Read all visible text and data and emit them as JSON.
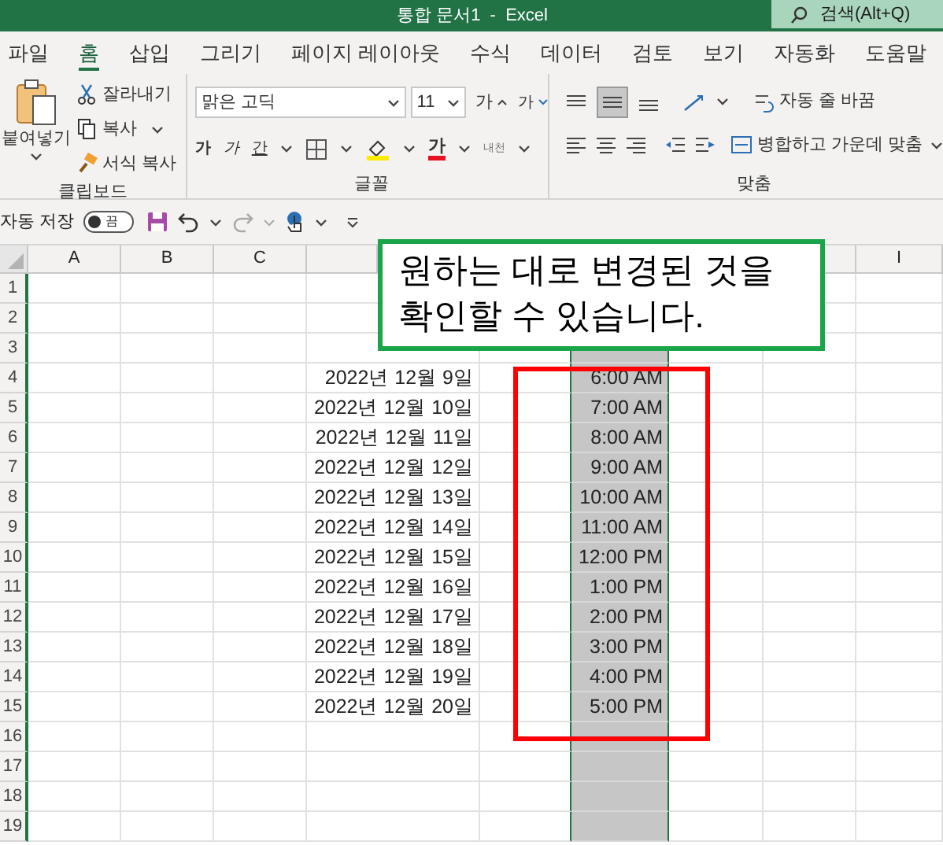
{
  "window": {
    "title": "통합 문서1  -  Excel",
    "search": {
      "placeholder": "검색(Alt+Q)"
    }
  },
  "tabs": [
    {
      "label": "파일",
      "selected": false
    },
    {
      "label": "홈",
      "selected": true
    },
    {
      "label": "삽입",
      "selected": false
    },
    {
      "label": "그리기",
      "selected": false
    },
    {
      "label": "페이지 레이아웃",
      "selected": false
    },
    {
      "label": "수식",
      "selected": false
    },
    {
      "label": "데이터",
      "selected": false
    },
    {
      "label": "검토",
      "selected": false
    },
    {
      "label": "보기",
      "selected": false
    },
    {
      "label": "자동화",
      "selected": false
    },
    {
      "label": "도움말",
      "selected": false
    }
  ],
  "ribbon": {
    "clipboard": {
      "paste": "붙여넣기",
      "cut": "잘라내기",
      "copy": "복사",
      "format_painter": "서식 복사",
      "label": "클립보드"
    },
    "font": {
      "font_name": "맑은 고딕",
      "font_size": "11",
      "grow": "가",
      "shrink": "가",
      "bold": "가",
      "italic": "가",
      "underline": "간",
      "font_color": "가",
      "phonetic": "내천",
      "label": "글꼴"
    },
    "alignment": {
      "wrap_text": "자동 줄 바꿈",
      "merge_center": "병합하고 가운데 맞춤",
      "label": "맞춤"
    }
  },
  "quick_access": {
    "autosave_label": "자동 저장",
    "autosave": {
      "on": false,
      "text": "끔"
    }
  },
  "columns": [
    "A",
    "B",
    "C",
    "I"
  ],
  "rows": [
    {
      "header": "1"
    },
    {
      "header": "2"
    },
    {
      "header": "3",
      "column_6_selected": true
    },
    {
      "header": "4",
      "date": "2022년 12월 9일",
      "time": "6:00 AM",
      "column_6_selected": true
    },
    {
      "header": "5",
      "date": "2022년 12월 10일",
      "time": "7:00 AM",
      "column_6_selected": true
    },
    {
      "header": "6",
      "date": "2022년 12월 11일",
      "time": "8:00 AM",
      "column_6_selected": true
    },
    {
      "header": "7",
      "date": "2022년 12월 12일",
      "time": "9:00 AM",
      "column_6_selected": true
    },
    {
      "header": "8",
      "date": "2022년 12월 13일",
      "time": "10:00 AM",
      "column_6_selected": true
    },
    {
      "header": "9",
      "date": "2022년 12월 14일",
      "time": "11:00 AM",
      "column_6_selected": true
    },
    {
      "header": "10",
      "date": "2022년 12월 15일",
      "time": "12:00 PM",
      "column_6_selected": true
    },
    {
      "header": "11",
      "date": "2022년 12월 16일",
      "time": "1:00 PM",
      "column_6_selected": true
    },
    {
      "header": "12",
      "date": "2022년 12월 17일",
      "time": "2:00 PM",
      "column_6_selected": true
    },
    {
      "header": "13",
      "date": "2022년 12월 18일",
      "time": "3:00 PM",
      "column_6_selected": true
    },
    {
      "header": "14",
      "date": "2022년 12월 19일",
      "time": "4:00 PM",
      "column_6_selected": true
    },
    {
      "header": "15",
      "date": "2022년 12월 20일",
      "time": "5:00 PM",
      "column_6_selected": true
    },
    {
      "header": "16",
      "column_6_selected": true
    },
    {
      "header": "17",
      "column_6_selected": true
    },
    {
      "header": "18",
      "column_6_selected": true
    },
    {
      "header": "19",
      "column_6_selected": true
    }
  ],
  "callout": {
    "text": "원하는 대로 변경된 것을 확인할 수 있습니다."
  }
}
